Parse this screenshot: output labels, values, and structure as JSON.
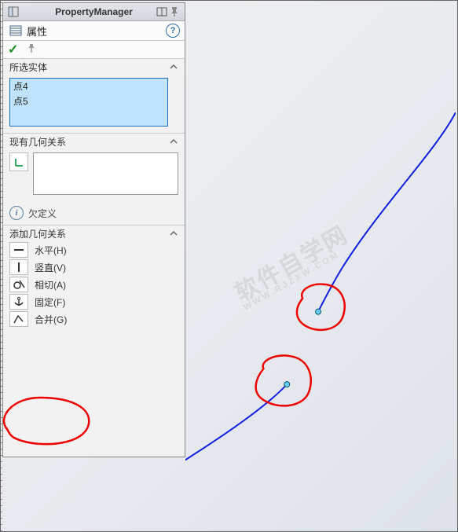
{
  "titlebar": {
    "title": "PropertyManager"
  },
  "header": {
    "properties_label": "属性",
    "help_symbol": "?"
  },
  "confirm": {
    "ok_symbol": "✓"
  },
  "sections": {
    "selected": {
      "title": "所选实体",
      "items": [
        "点4",
        "点5"
      ]
    },
    "existing": {
      "title": "现有几何关系"
    },
    "info": {
      "icon_glyph": "i",
      "text": "欠定义"
    },
    "add": {
      "title": "添加几何关系",
      "items": [
        {
          "name": "horizontal",
          "label": "水平(H)"
        },
        {
          "name": "vertical",
          "label": "竖直(V)"
        },
        {
          "name": "tangent",
          "label": "相切(A)"
        },
        {
          "name": "fix",
          "label": "固定(F)"
        },
        {
          "name": "merge",
          "label": "合并(G)"
        }
      ]
    }
  }
}
